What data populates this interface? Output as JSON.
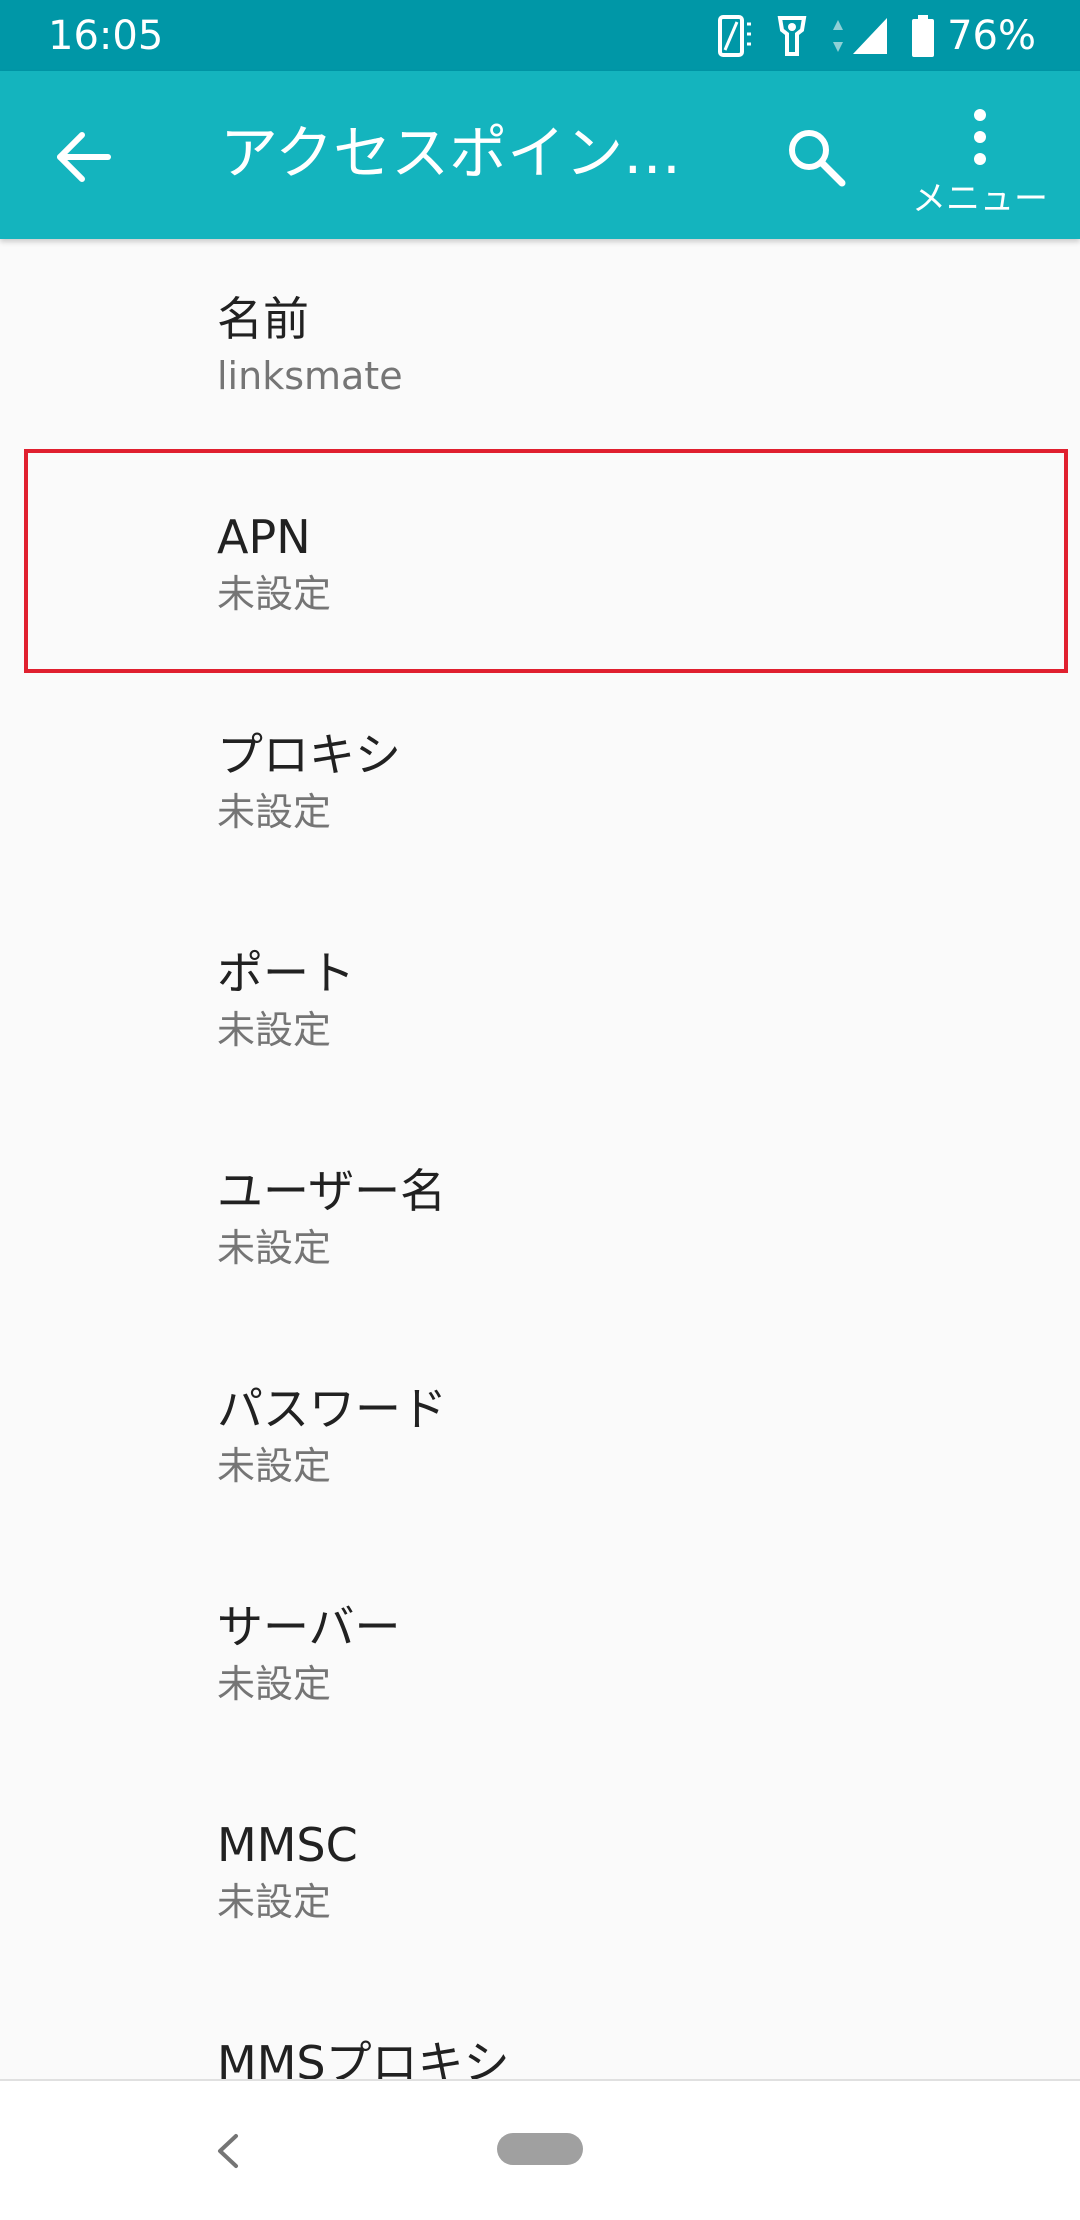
{
  "status_bar": {
    "time": "16:05",
    "battery_percent": "76%",
    "icons": [
      "vibrate-icon",
      "data-saver-icon",
      "data-arrows-icon",
      "signal-icon",
      "battery-icon"
    ]
  },
  "app_bar": {
    "title": "アクセスポイン…",
    "menu_label": "メニュー",
    "background_color": "#14b4be"
  },
  "apn_fields": [
    {
      "title": "名前",
      "value": "linksmate"
    },
    {
      "title": "APN",
      "value": "未設定",
      "highlighted": true,
      "highlight_color": "#e0202f"
    },
    {
      "title": "プロキシ",
      "value": "未設定"
    },
    {
      "title": "ポート",
      "value": "未設定"
    },
    {
      "title": "ユーザー名",
      "value": "未設定"
    },
    {
      "title": "パスワード",
      "value": "未設定"
    },
    {
      "title": "サーバー",
      "value": "未設定"
    },
    {
      "title": "MMSC",
      "value": "未設定"
    },
    {
      "title": "MMSプロキシ",
      "value": ""
    }
  ]
}
